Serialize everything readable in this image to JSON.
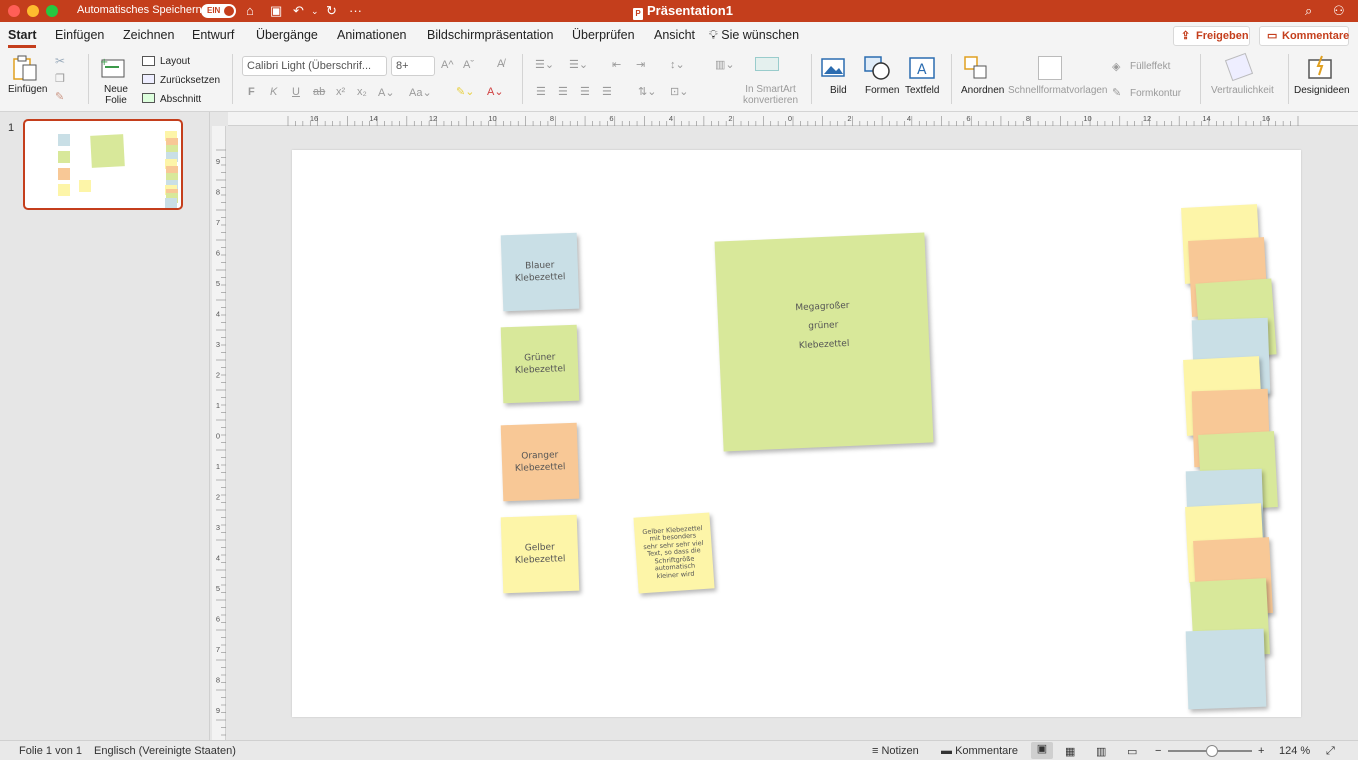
{
  "titlebar": {
    "autosave_label": "Automatisches Speichern",
    "autosave_state": "EIN",
    "document_title": "Präsentation1"
  },
  "tabs": [
    {
      "label": "Start",
      "active": true
    },
    {
      "label": "Einfügen"
    },
    {
      "label": "Zeichnen"
    },
    {
      "label": "Entwurf"
    },
    {
      "label": "Übergänge"
    },
    {
      "label": "Animationen"
    },
    {
      "label": "Bildschirmpräsentation"
    },
    {
      "label": "Überprüfen"
    },
    {
      "label": "Ansicht"
    },
    {
      "label": "Sie wünschen"
    }
  ],
  "actions": {
    "share": "Freigeben",
    "comments": "Kommentare"
  },
  "ribbon": {
    "paste": "Einfügen",
    "new_slide": "Neue\nFolie",
    "layout": "Layout",
    "reset": "Zurücksetzen",
    "section": "Abschnitt",
    "font_name": "Calibri Light (Überschrif...",
    "font_size": "8+",
    "bold": "F",
    "italic": "K",
    "underline": "U",
    "smartart": "In SmartArt\nkonvertieren",
    "picture": "Bild",
    "shapes": "Formen",
    "textbox": "Textfeld",
    "arrange": "Anordnen",
    "quick_styles": "Schnellformatvorlagen",
    "shape_fill": "Fülleffekt",
    "shape_outline": "Formkontur",
    "sensitivity": "Vertraulichkeit",
    "design_ideas": "Designideen"
  },
  "thumbnails": [
    {
      "number": "1"
    }
  ],
  "slide": {
    "notes": [
      {
        "text": "Blauer\nKlebezettel",
        "color": "#c9dfe6"
      },
      {
        "text": "Grüner\nKlebezettel",
        "color": "#d8e89a"
      },
      {
        "text": "Oranger\nKlebezettel",
        "color": "#f8c896"
      },
      {
        "text": "Gelber\nKlebezettel",
        "color": "#fdf5a8"
      },
      {
        "text": "Gelber Klebezettel\nmit besonders\nsehr sehr sehr viel\nText, so dass die\nSchriftgröße\nautomatisch\nkleiner wird",
        "color": "#fdf5a8"
      },
      {
        "text": "Megagroßer\n\ngrüner\n\nKlebezettel",
        "color": "#d8e89a"
      }
    ],
    "stack_colors": [
      "#fdf5a8",
      "#f8c896",
      "#d8e89a",
      "#c9dfe6"
    ]
  },
  "ruler": {
    "h_ticks": [
      "16",
      "14",
      "12",
      "10",
      "8",
      "6",
      "4",
      "2",
      "0",
      "2",
      "4",
      "6",
      "8",
      "10",
      "12",
      "14",
      "16"
    ],
    "v_ticks": [
      "9",
      "8",
      "7",
      "6",
      "5",
      "4",
      "3",
      "2",
      "1",
      "0",
      "1",
      "2",
      "3",
      "4",
      "5",
      "6",
      "7",
      "8",
      "9"
    ]
  },
  "statusbar": {
    "slide_info": "Folie 1 von 1",
    "language": "Englisch (Vereinigte Staaten)",
    "notes": "Notizen",
    "comments": "Kommentare",
    "zoom": "124 %"
  }
}
